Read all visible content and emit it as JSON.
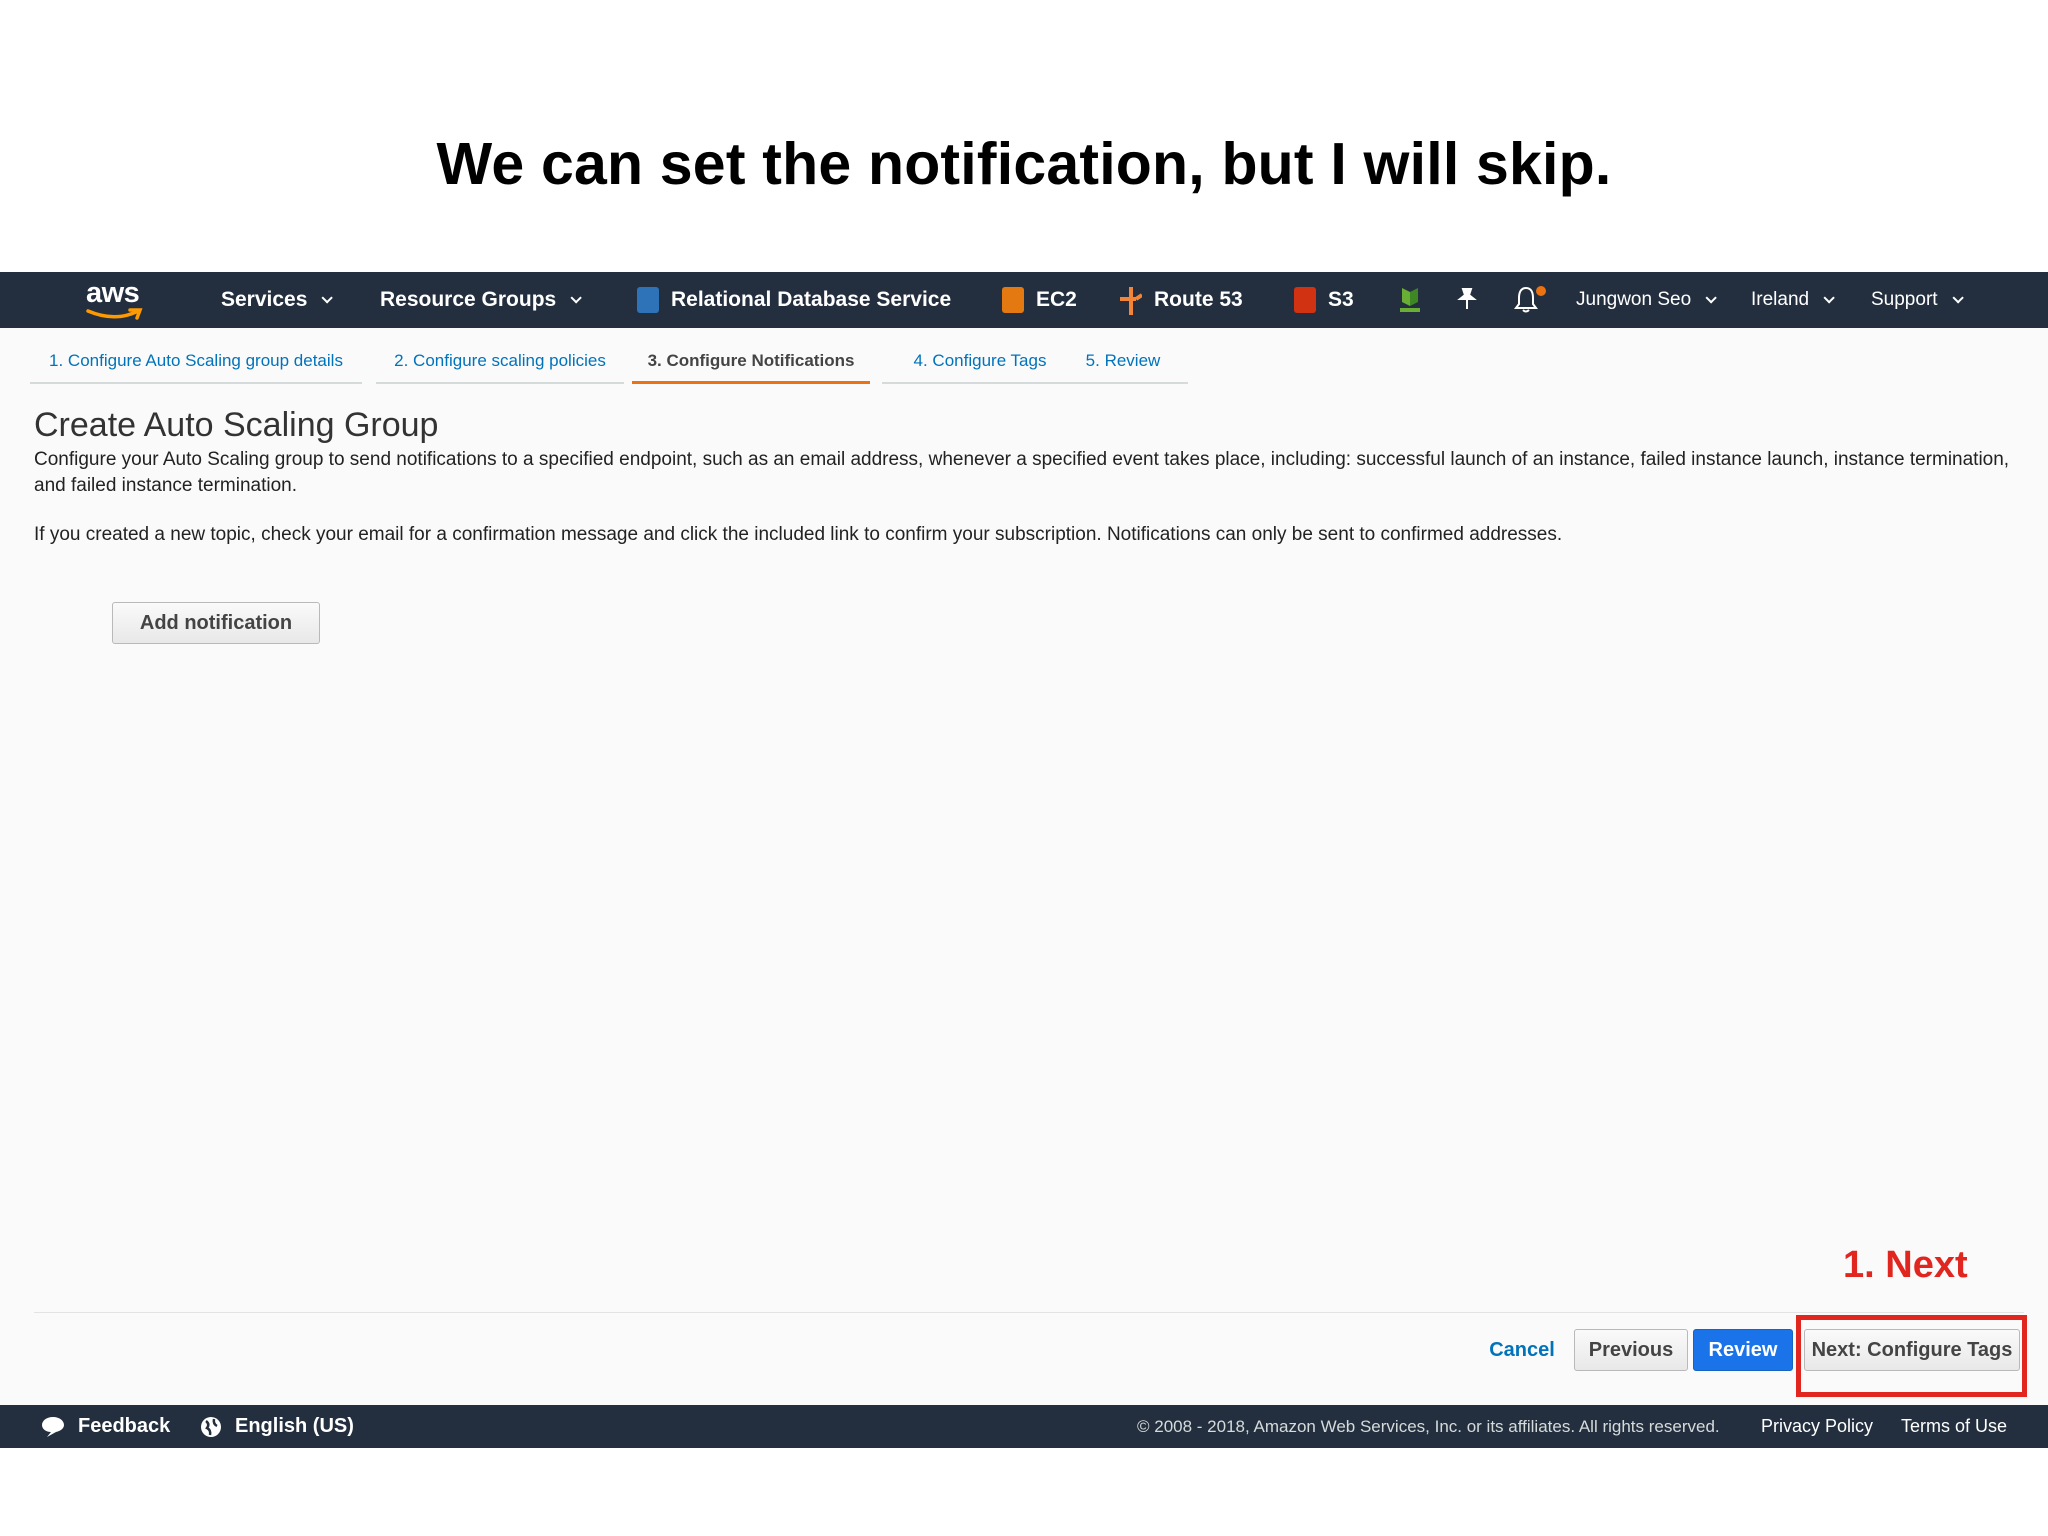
{
  "slide": {
    "title": "We can set the notification, but I will skip."
  },
  "nav": {
    "logo": "aws",
    "services": "Services",
    "resource_groups": "Resource Groups",
    "shortcuts": [
      "Relational Database Service",
      "EC2",
      "Route 53",
      "S3"
    ],
    "user": "Jungwon Seo",
    "region": "Ireland",
    "support": "Support"
  },
  "wizard": {
    "tabs": [
      "1. Configure Auto Scaling group details",
      "2. Configure scaling policies",
      "3. Configure Notifications",
      "4. Configure Tags",
      "5. Review"
    ],
    "active_index": 2
  },
  "page": {
    "title": "Create Auto Scaling Group",
    "description": "Configure your Auto Scaling group to send notifications to a specified endpoint, such as an email address, whenever a specified event takes place, including: successful launch of an instance, failed instance launch, instance termination, and failed instance termination.",
    "note": "If you created a new topic, check your email for a confirmation message and click the included link to confirm your subscription. Notifications can only be sent to confirmed addresses.",
    "add_notification": "Add notification"
  },
  "actions": {
    "cancel": "Cancel",
    "previous": "Previous",
    "review": "Review",
    "next": "Next: Configure Tags"
  },
  "annotation": {
    "label": "1. Next",
    "color": "#e0261f"
  },
  "footer": {
    "feedback": "Feedback",
    "language": "English (US)",
    "copyright": "© 2008 - 2018, Amazon Web Services, Inc. or its affiliates. All rights reserved.",
    "privacy": "Privacy Policy",
    "terms": "Terms of Use"
  },
  "colors": {
    "nav_bg": "#232f3e",
    "accent": "#ec7211",
    "link": "#0073bb",
    "primary": "#1a73e8"
  }
}
